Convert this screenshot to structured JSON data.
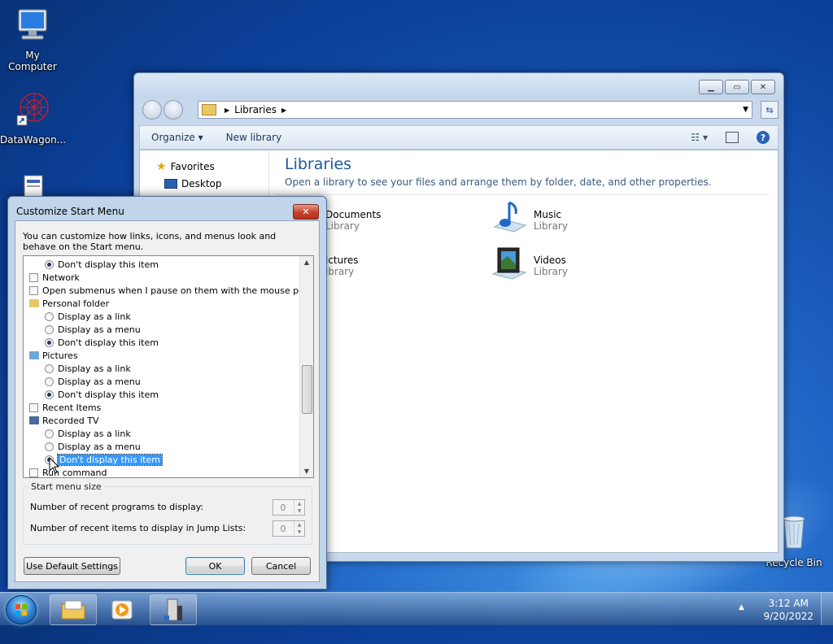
{
  "desktop": {
    "icons": [
      {
        "label": "My Computer"
      },
      {
        "label": "DataWagon..."
      },
      {
        "label": ""
      },
      {
        "label": "Recycle Bin"
      }
    ]
  },
  "explorer": {
    "address": {
      "crumb": "Libraries"
    },
    "toolbar": {
      "organize": "Organize ▾",
      "new_library": "New library"
    },
    "nav": {
      "favorites": "Favorites",
      "desktop": "Desktop"
    },
    "content": {
      "title": "Libraries",
      "subtitle": "Open a library to see your files and arrange them by folder, date, and other properties.",
      "libraries": [
        {
          "name": "Documents",
          "type": "Library"
        },
        {
          "name": "Music",
          "type": "Library"
        },
        {
          "name": "ictures",
          "type": "ibrary"
        },
        {
          "name": "Videos",
          "type": "Library"
        }
      ]
    }
  },
  "dialog": {
    "title": "Customize Start Menu",
    "description": "You can customize how links, icons, and menus look and behave on the Start menu.",
    "list": [
      {
        "kind": "radio",
        "label": "Don't display this item",
        "checked": true
      },
      {
        "kind": "checkbox",
        "label": "Network",
        "checked": false
      },
      {
        "kind": "checkbox",
        "label": "Open submenus when I pause on them with the mouse pointer",
        "checked": false
      },
      {
        "kind": "header",
        "label": "Personal folder",
        "icon": "user-folder-icon"
      },
      {
        "kind": "radio",
        "label": "Display as a link",
        "checked": false
      },
      {
        "kind": "radio",
        "label": "Display as a menu",
        "checked": false
      },
      {
        "kind": "radio",
        "label": "Don't display this item",
        "checked": true
      },
      {
        "kind": "header",
        "label": "Pictures",
        "icon": "pictures-icon"
      },
      {
        "kind": "radio",
        "label": "Display as a link",
        "checked": false
      },
      {
        "kind": "radio",
        "label": "Display as a menu",
        "checked": false
      },
      {
        "kind": "radio",
        "label": "Don't display this item",
        "checked": true
      },
      {
        "kind": "checkbox",
        "label": "Recent Items",
        "checked": false
      },
      {
        "kind": "header",
        "label": "Recorded TV",
        "icon": "tv-icon"
      },
      {
        "kind": "radio",
        "label": "Display as a link",
        "checked": false
      },
      {
        "kind": "radio",
        "label": "Display as a menu",
        "checked": false
      },
      {
        "kind": "radio",
        "label": "Don't display this item",
        "checked": true,
        "selected": true
      },
      {
        "kind": "checkbox",
        "label": "Run command",
        "checked": false
      }
    ],
    "size_group": {
      "label": "Start menu size",
      "recent_programs_label": "Number of recent programs to display:",
      "recent_programs_value": "0",
      "jump_list_label": "Number of recent items to display in Jump Lists:",
      "jump_list_value": "0"
    },
    "buttons": {
      "defaults": "Use Default Settings",
      "ok": "OK",
      "cancel": "Cancel"
    }
  },
  "taskbar": {
    "time": "3:12 AM",
    "date": "9/20/2022"
  },
  "colors": {
    "selection": "#3399ff",
    "title_text": "#1e5a9a",
    "close_button": "#c6402a"
  }
}
